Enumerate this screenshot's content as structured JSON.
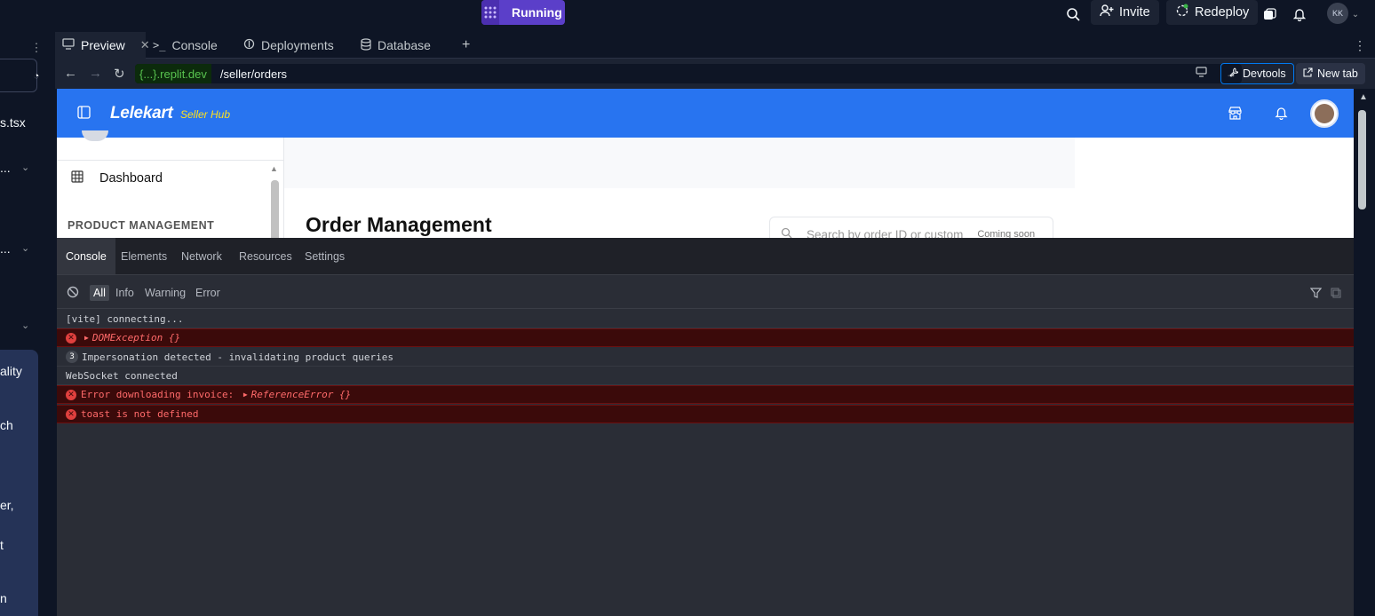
{
  "topbar": {
    "run_label": "Running",
    "invite_label": "Invite",
    "redeploy_label": "Redeploy",
    "user_initials": "KK"
  },
  "left_panel": {
    "fragments": [
      "s.tsx",
      "...",
      "...",
      "ality",
      "ch",
      "er,",
      "t",
      "n"
    ]
  },
  "tabs": [
    {
      "label": "Preview",
      "icon": "monitor-icon"
    },
    {
      "label": "Console",
      "icon": "terminal-icon"
    },
    {
      "label": "Deployments",
      "icon": "deploy-icon"
    },
    {
      "label": "Database",
      "icon": "database-icon"
    }
  ],
  "url_bar": {
    "host": "{...}.replit.dev",
    "path": "/seller/orders",
    "devtools_label": "Devtools",
    "newtab_label": "New tab"
  },
  "app": {
    "brand": "Lelekart",
    "brand_sub": "Seller Hub",
    "sidebar_item": "Dashboard",
    "sidebar_section": "PRODUCT MANAGEMENT",
    "page_title": "Order Management",
    "search_placeholder": "Search by order ID or custom",
    "search_badge": "Coming soon"
  },
  "devtools": {
    "tabs": [
      "Console",
      "Elements",
      "Network",
      "Resources",
      "Settings"
    ],
    "filters": [
      "All",
      "Info",
      "Warning",
      "Error"
    ],
    "logs": [
      {
        "type": "log",
        "text": "[vite] connecting..."
      },
      {
        "type": "error",
        "text": "DOMException {}"
      },
      {
        "type": "log",
        "count": "3",
        "text": "Impersonation detected - invalidating product queries"
      },
      {
        "type": "log",
        "text": "WebSocket connected"
      },
      {
        "type": "error",
        "text": "Error downloading invoice: ",
        "obj": "ReferenceError {}"
      },
      {
        "type": "error",
        "text": "toast is not defined"
      }
    ]
  },
  "colors": {
    "accent": "#2874f0",
    "run": "#5b3fc9",
    "error_bg": "#3b0a0a",
    "error_text": "#ff6a6a",
    "host_green": "#58c34f"
  }
}
